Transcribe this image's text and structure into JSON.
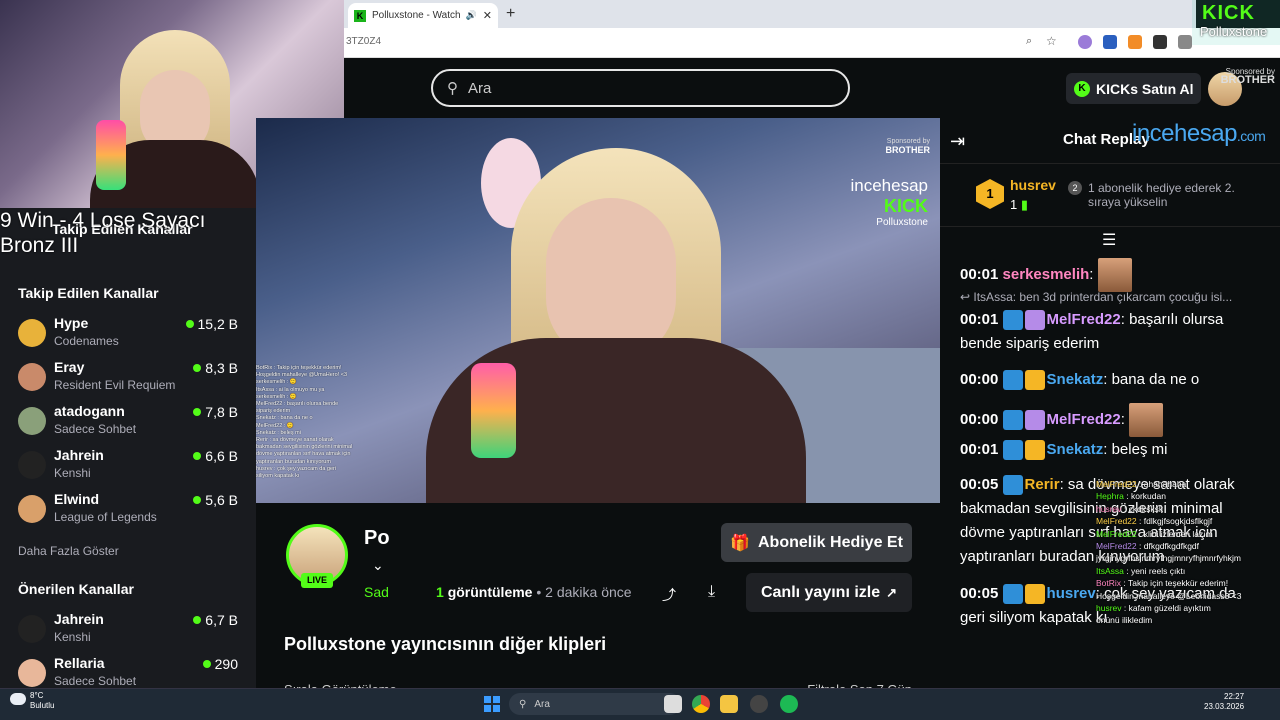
{
  "overlay": {
    "winrecord_line1": "9 Win - 4 Lose Sayacı",
    "winrecord_line2": "Bronz III",
    "ghost_followed_title": "Takip Edilen Kanallar"
  },
  "brand": {
    "logo": "KICK",
    "channel": "Polluxstone"
  },
  "browser": {
    "tab_title": "Polluxstone - Watch clips o",
    "new_tab_symbol": "+",
    "url_fragment": "3TZ0Z4"
  },
  "header": {
    "search_placeholder": "Ara",
    "kicks_label": "KICKs Satın Al",
    "sponsor_small": "Sponsored by",
    "sponsor_name": "BROTHER"
  },
  "sidebar": {
    "followed_title": "Takip Edilen Kanallar",
    "followed": [
      {
        "name": "Hype",
        "category": "Codenames",
        "viewers": "15,2 B",
        "avatar_color": "#e8b23a"
      },
      {
        "name": "Eray",
        "category": "Resident Evil Requiem",
        "viewers": "8,3 B",
        "avatar_color": "#c98a6a"
      },
      {
        "name": "atadogann",
        "category": "Sadece Sohbet",
        "viewers": "7,8 B",
        "avatar_color": "#8aa07a"
      },
      {
        "name": "Jahrein",
        "category": "Kenshi",
        "viewers": "6,6 B",
        "avatar_color": "#222222"
      },
      {
        "name": "Elwind",
        "category": "League of Legends",
        "viewers": "5,6 B",
        "avatar_color": "#d9a06a"
      }
    ],
    "more_label": "Daha Fazla Göster",
    "recommended_title": "Önerilen Kanallar",
    "recommended": [
      {
        "name": "Jahrein",
        "category": "Kenshi",
        "viewers": "6,7 B",
        "avatar_color": "#222222"
      },
      {
        "name": "Rellaria",
        "category": "Sadece Sohbet",
        "viewers": "290",
        "avatar_color": "#e8b79a"
      }
    ]
  },
  "video": {
    "overlay_brand": "incehesap",
    "overlay_kick": "KICK",
    "overlay_channel": "Polluxstone",
    "sponsor_small": "Sponsored by",
    "sponsor_name": "BROTHER",
    "mini_chat": [
      "BotRix : Takip için teşekkür ederim!",
      "Hoşgeldin mahalleye @UmaHero! <3",
      "serkesmelih : 🙂",
      "ItsAssa : ai la olmuyo mu ya",
      "serkesmelih : 🙂",
      "MelFred22 : başarılı olursa bende",
      "sipariş ederim",
      "Snekatz : bana da ne o",
      "MelFred22 : 🙂",
      "Snekatz : beleş mi",
      "Rerir : sa dövmeye sanat olarak",
      "bakmadan sevgilisinin gözlerini minimal",
      "dövme yaptıranları sırf hava atmak için",
      "yaptıranları buradan kınıyorum",
      "husrev : çok şey yazıcam da geri",
      "siliyom kapatak kı"
    ]
  },
  "stream_info": {
    "live_label": "LIVE",
    "name_short": "Po",
    "category_short": "Sad",
    "views_count": "1",
    "views_label": "görüntüleme",
    "time_ago": "2 dakika önce",
    "subscribe_gift_label": "Abonelik Hediye Et",
    "watch_live_label": "Canlı yayını izle",
    "other_clips_title": "Polluxstone yayıncısının diğer klipleri",
    "sort_label": "Sırala",
    "sort_value": "Görüntüleme",
    "filter_label": "Filtrele",
    "filter_value": "Son 7 Gün"
  },
  "chat": {
    "title": "Chat Replay",
    "overlay_brand": "incehesap",
    "overlay_brand_suffix": ".com",
    "pinned": {
      "badge_number": "1",
      "user": "husrev",
      "count": "1",
      "gift_number": "2",
      "text": "1 abonelik hediye ederek 2. sıraya yükselin"
    },
    "messages": [
      {
        "ts": "00:01",
        "user": "serkesmelih",
        "color": "#ff86c0",
        "text": ""
      },
      {
        "reply": "ItsAssa: ben 3d printerdan çıkarcam çocuğu isi..."
      },
      {
        "ts": "00:01",
        "user": "MelFred22",
        "color": "#d79bff",
        "text": " başarılı olursa bende sipariş ederim"
      },
      {
        "ts": "00:00",
        "user": "Snekatz",
        "color": "#4aa8f0",
        "text": " bana da ne o"
      },
      {
        "ts": "00:00",
        "user": "MelFred22",
        "color": "#d79bff",
        "text": ""
      },
      {
        "ts": "00:01",
        "user": "Snekatz",
        "color": "#4aa8f0",
        "text": " beleş mi"
      },
      {
        "ts": "00:05",
        "user": "Rerir",
        "color": "#f5b625",
        "text": " sa dövmeye sanat olarak bakmadan sevgilisinin gözlerini minimal dövme yaptıranları sırf hava atmak için yaptıranları buradan kınıyorum"
      },
      {
        "ts": "00:05",
        "user": "husrev",
        "color": "#4aa8f0",
        "text": " çok şey yazıcam da geri siliyom kapatak kı"
      }
    ]
  },
  "overlay_chat": [
    {
      "user": "",
      "text": ""
    },
    {
      "user": "MelFred22",
      "text": " : ahahahaha"
    },
    {
      "user": "Hephra",
      "text": " : korkudan"
    },
    {
      "user": "",
      "text": ""
    },
    {
      "user": "husrev",
      "text": " : ckdksksk"
    },
    {
      "user": "MelFred22",
      "text": " : fdlkgjfsogkjdsflkgjf"
    },
    {
      "user": "MelFred22",
      "text": " : klibi izlemen lazım"
    },
    {
      "user": "MelFred22",
      "text": " : dfkgdfkgdfkgdf"
    },
    {
      "user": "",
      "text": ""
    },
    {
      "user": "",
      "text": "jyrgjnygrfhsjnmryfhgjmnryfhjmnrfyhkjm"
    },
    {
      "user": "ItsAssa",
      "text": " : yeni reels çıktı"
    },
    {
      "user": "",
      "text": ""
    },
    {
      "user": "BotRix",
      "text": " : Takip için teşekkür ederim!"
    },
    {
      "user": "",
      "text": "Hoşgeldin mahalleye @Leonidass3 <3"
    },
    {
      "user": "husrev",
      "text": " : kafam güzeldi ayıktım"
    },
    {
      "user": "",
      "text": "önünü ilikledim"
    }
  ],
  "taskbar": {
    "temp": "8°C",
    "weather": "Bulutlu",
    "search_placeholder": "Ara",
    "time": "22:27",
    "date": "23.03.2026"
  }
}
